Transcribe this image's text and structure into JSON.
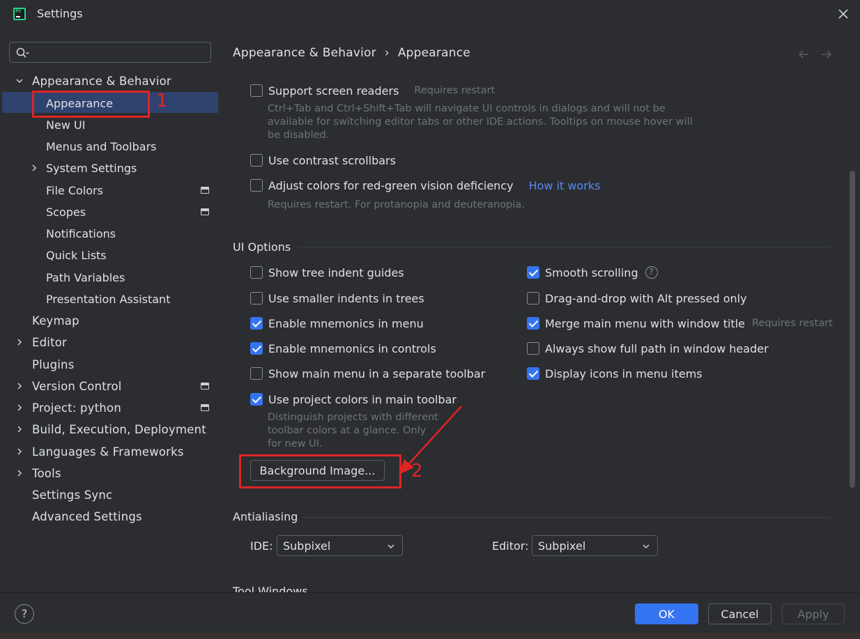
{
  "window": {
    "title": "Settings"
  },
  "search": {
    "value": "",
    "placeholder": ""
  },
  "sidebar": {
    "items": [
      {
        "label": "Appearance & Behavior",
        "expanded": true
      },
      {
        "label": "Appearance",
        "selected": true
      },
      {
        "label": "New UI"
      },
      {
        "label": "Menus and Toolbars"
      },
      {
        "label": "System Settings"
      },
      {
        "label": "File Colors"
      },
      {
        "label": "Scopes"
      },
      {
        "label": "Notifications"
      },
      {
        "label": "Quick Lists"
      },
      {
        "label": "Path Variables"
      },
      {
        "label": "Presentation Assistant"
      },
      {
        "label": "Keymap"
      },
      {
        "label": "Editor"
      },
      {
        "label": "Plugins"
      },
      {
        "label": "Version Control"
      },
      {
        "label": "Project: python"
      },
      {
        "label": "Build, Execution, Deployment"
      },
      {
        "label": "Languages & Frameworks"
      },
      {
        "label": "Tools"
      },
      {
        "label": "Settings Sync"
      },
      {
        "label": "Advanced Settings"
      }
    ]
  },
  "breadcrumb": {
    "parent": "Appearance & Behavior",
    "separator": "›",
    "current": "Appearance"
  },
  "accessibility": {
    "screen_readers": {
      "label": "Support screen readers",
      "hint": "Requires restart",
      "checked": false,
      "description": "Ctrl+Tab and Ctrl+Shift+Tab will navigate UI controls in dialogs and will not be available for switching editor tabs or other IDE actions. Tooltips on mouse hover will be disabled."
    },
    "contrast_scrollbars": {
      "label": "Use contrast scrollbars",
      "checked": false
    },
    "red_green": {
      "label": "Adjust colors for red-green vision deficiency",
      "link": "How it works",
      "checked": false,
      "description": "Requires restart. For protanopia and deuteranopia."
    }
  },
  "ui_options": {
    "title": "UI Options",
    "tree_indent": {
      "label": "Show tree indent guides",
      "checked": false
    },
    "smaller_indents": {
      "label": "Use smaller indents in trees",
      "checked": false
    },
    "mnemonics_menu": {
      "label": "Enable mnemonics in menu",
      "checked": true
    },
    "mnemonics_controls": {
      "label": "Enable mnemonics in controls",
      "checked": true
    },
    "main_menu_toolbar": {
      "label": "Show main menu in a separate toolbar",
      "checked": false
    },
    "project_colors": {
      "label": "Use project colors in main toolbar",
      "checked": true,
      "description": "Distinguish projects with different toolbar colors at a glance. Only for new UI."
    },
    "smooth_scrolling": {
      "label": "Smooth scrolling",
      "help": "?",
      "checked": true
    },
    "drag_drop_alt": {
      "label": "Drag-and-drop with Alt pressed only",
      "checked": false
    },
    "merge_menu": {
      "label": "Merge main menu with window title",
      "hint": "Requires restart",
      "checked": true
    },
    "full_path": {
      "label": "Always show full path in window header",
      "checked": false
    },
    "display_icons": {
      "label": "Display icons in menu items",
      "checked": true
    },
    "background_button": "Background Image..."
  },
  "antialiasing": {
    "title": "Antialiasing",
    "ide_label": "IDE:",
    "ide_value": "Subpixel",
    "editor_label": "Editor:",
    "editor_value": "Subpixel"
  },
  "tool_windows": {
    "title": "Tool Windows"
  },
  "annotations": {
    "one": "1",
    "two": "2"
  },
  "footer": {
    "help": "?",
    "ok": "OK",
    "cancel": "Cancel",
    "apply": "Apply"
  },
  "colors": {
    "accent": "#3574f0",
    "selection": "#2e436e",
    "annotation": "#e02424",
    "link": "#548af7"
  }
}
